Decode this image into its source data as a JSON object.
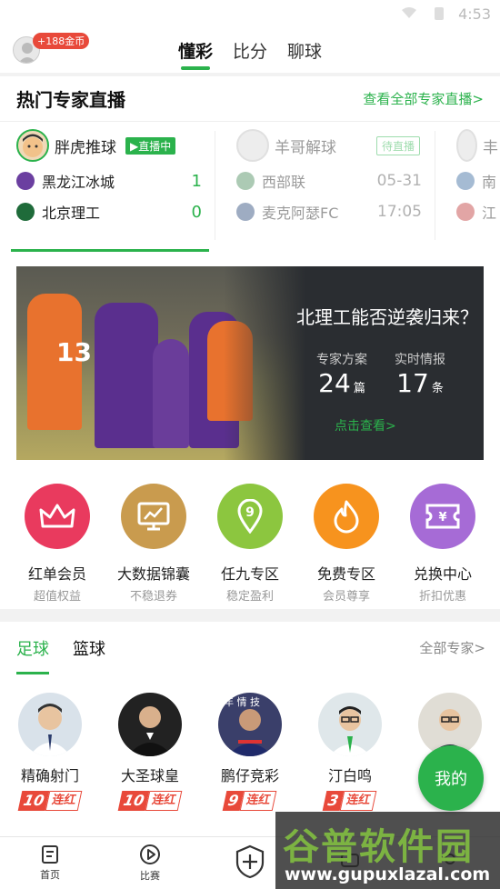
{
  "status": {
    "time": "4:53"
  },
  "topnav": {
    "coin_badge": "+188金币",
    "tabs": [
      {
        "label": "懂彩",
        "active": true
      },
      {
        "label": "比分",
        "active": false
      },
      {
        "label": "聊球",
        "active": false
      }
    ]
  },
  "live": {
    "title": "热门专家直播",
    "more": "查看全部专家直播>",
    "cards": [
      {
        "expert": "胖虎推球",
        "tag": "▶直播中",
        "home": "黑龙江冰城",
        "home_score": "1",
        "away": "北京理工",
        "away_score": "0"
      },
      {
        "expert": "羊哥解球",
        "tag": "待直播",
        "home": "西部联",
        "home_score": "05-31",
        "away": "麦克阿瑟FC",
        "away_score": "17:05"
      },
      {
        "expert": "丰",
        "tag": "",
        "home": "南",
        "home_score": "",
        "away": "江",
        "away_score": ""
      }
    ]
  },
  "banner": {
    "title": "北理工能否逆袭归来？",
    "plans_label": "专家方案",
    "plans_num": "24",
    "plans_unit": "篇",
    "intel_label": "实时情报",
    "intel_num": "17",
    "intel_unit": "条",
    "cta": "点击查看>"
  },
  "quick": [
    {
      "label": "红单会员",
      "sub": "超值权益",
      "color": "#e93a5e",
      "icon": "crown-icon"
    },
    {
      "label": "大数据锦囊",
      "sub": "不稳退券",
      "color": "#c99b4e",
      "icon": "chart-screen-icon"
    },
    {
      "label": "任九专区",
      "sub": "稳定盈利",
      "color": "#8cc63f",
      "icon": "nine-pin-icon"
    },
    {
      "label": "免费专区",
      "sub": "会员尊享",
      "color": "#f7931e",
      "icon": "flame-icon"
    },
    {
      "label": "兑换中心",
      "sub": "折扣优惠",
      "color": "#a66bd6",
      "icon": "ticket-icon"
    }
  ],
  "sport": {
    "tabs": [
      {
        "label": "足球",
        "active": true
      },
      {
        "label": "篮球",
        "active": false
      }
    ],
    "all": "全部专家>",
    "experts": [
      {
        "name": "精确射门",
        "streak": "10",
        "word": "连红"
      },
      {
        "name": "大圣球皇",
        "streak": "10",
        "word": "连红"
      },
      {
        "name": "鹏仔竞彩",
        "streak": "9",
        "word": "连红"
      },
      {
        "name": "汀白鸣",
        "streak": "3",
        "word": "连红"
      },
      {
        "name": "",
        "streak": "",
        "word": ""
      }
    ]
  },
  "chat_fab": "我的",
  "bottom": [
    {
      "label": "首页",
      "icon": "doc-icon"
    },
    {
      "label": "比赛",
      "icon": "play-icon"
    },
    {
      "label": "",
      "icon": "shield-plus-icon"
    },
    {
      "label": "",
      "icon": "chat-icon"
    },
    {
      "label": "",
      "icon": "user-icon"
    }
  ],
  "watermark": {
    "big": "谷普软件园",
    "url": "www.gupuxlazal.com"
  }
}
